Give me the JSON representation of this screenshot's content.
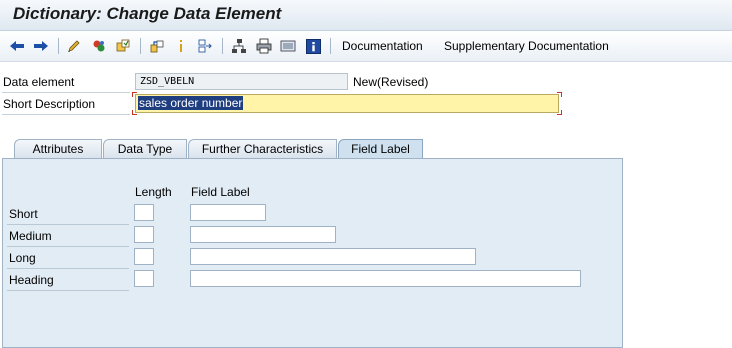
{
  "window": {
    "title": "Dictionary: Change Data Element"
  },
  "toolbar": {
    "icons": [
      "back-arrow-icon",
      "forward-arrow-icon",
      "edit-pencil-icon",
      "check-object-icon",
      "activate-object-icon",
      "where-used-icon",
      "info-marker-icon",
      "navigate-icon",
      "hierarchy-icon",
      "print-icon",
      "display-list-icon",
      "information-icon"
    ],
    "documentation": "Documentation",
    "supplementary_documentation": "Supplementary Documentation"
  },
  "header": {
    "data_element_label": "Data element",
    "data_element_value": "ZSD_VBELN",
    "status": "New(Revised)",
    "short_description_label": "Short Description",
    "short_description_value": "sales order number"
  },
  "tabs": [
    {
      "label": "Attributes",
      "active": false
    },
    {
      "label": "Data Type",
      "active": false
    },
    {
      "label": "Further Characteristics",
      "active": false
    },
    {
      "label": "Field Label",
      "active": true
    }
  ],
  "field_label_panel": {
    "col_length": "Length",
    "col_field_label": "Field Label",
    "rows": [
      {
        "label": "Short",
        "length": "",
        "field_label": ""
      },
      {
        "label": "Medium",
        "length": "",
        "field_label": ""
      },
      {
        "label": "Long",
        "length": "",
        "field_label": ""
      },
      {
        "label": "Heading",
        "length": "",
        "field_label": ""
      }
    ]
  },
  "colors": {
    "titlebar": "#dfe8f1",
    "panel": "#e2ecf5",
    "edit_field": "#fff4a8",
    "selection": "#1f3e80",
    "required_corner": "#c8321e"
  }
}
